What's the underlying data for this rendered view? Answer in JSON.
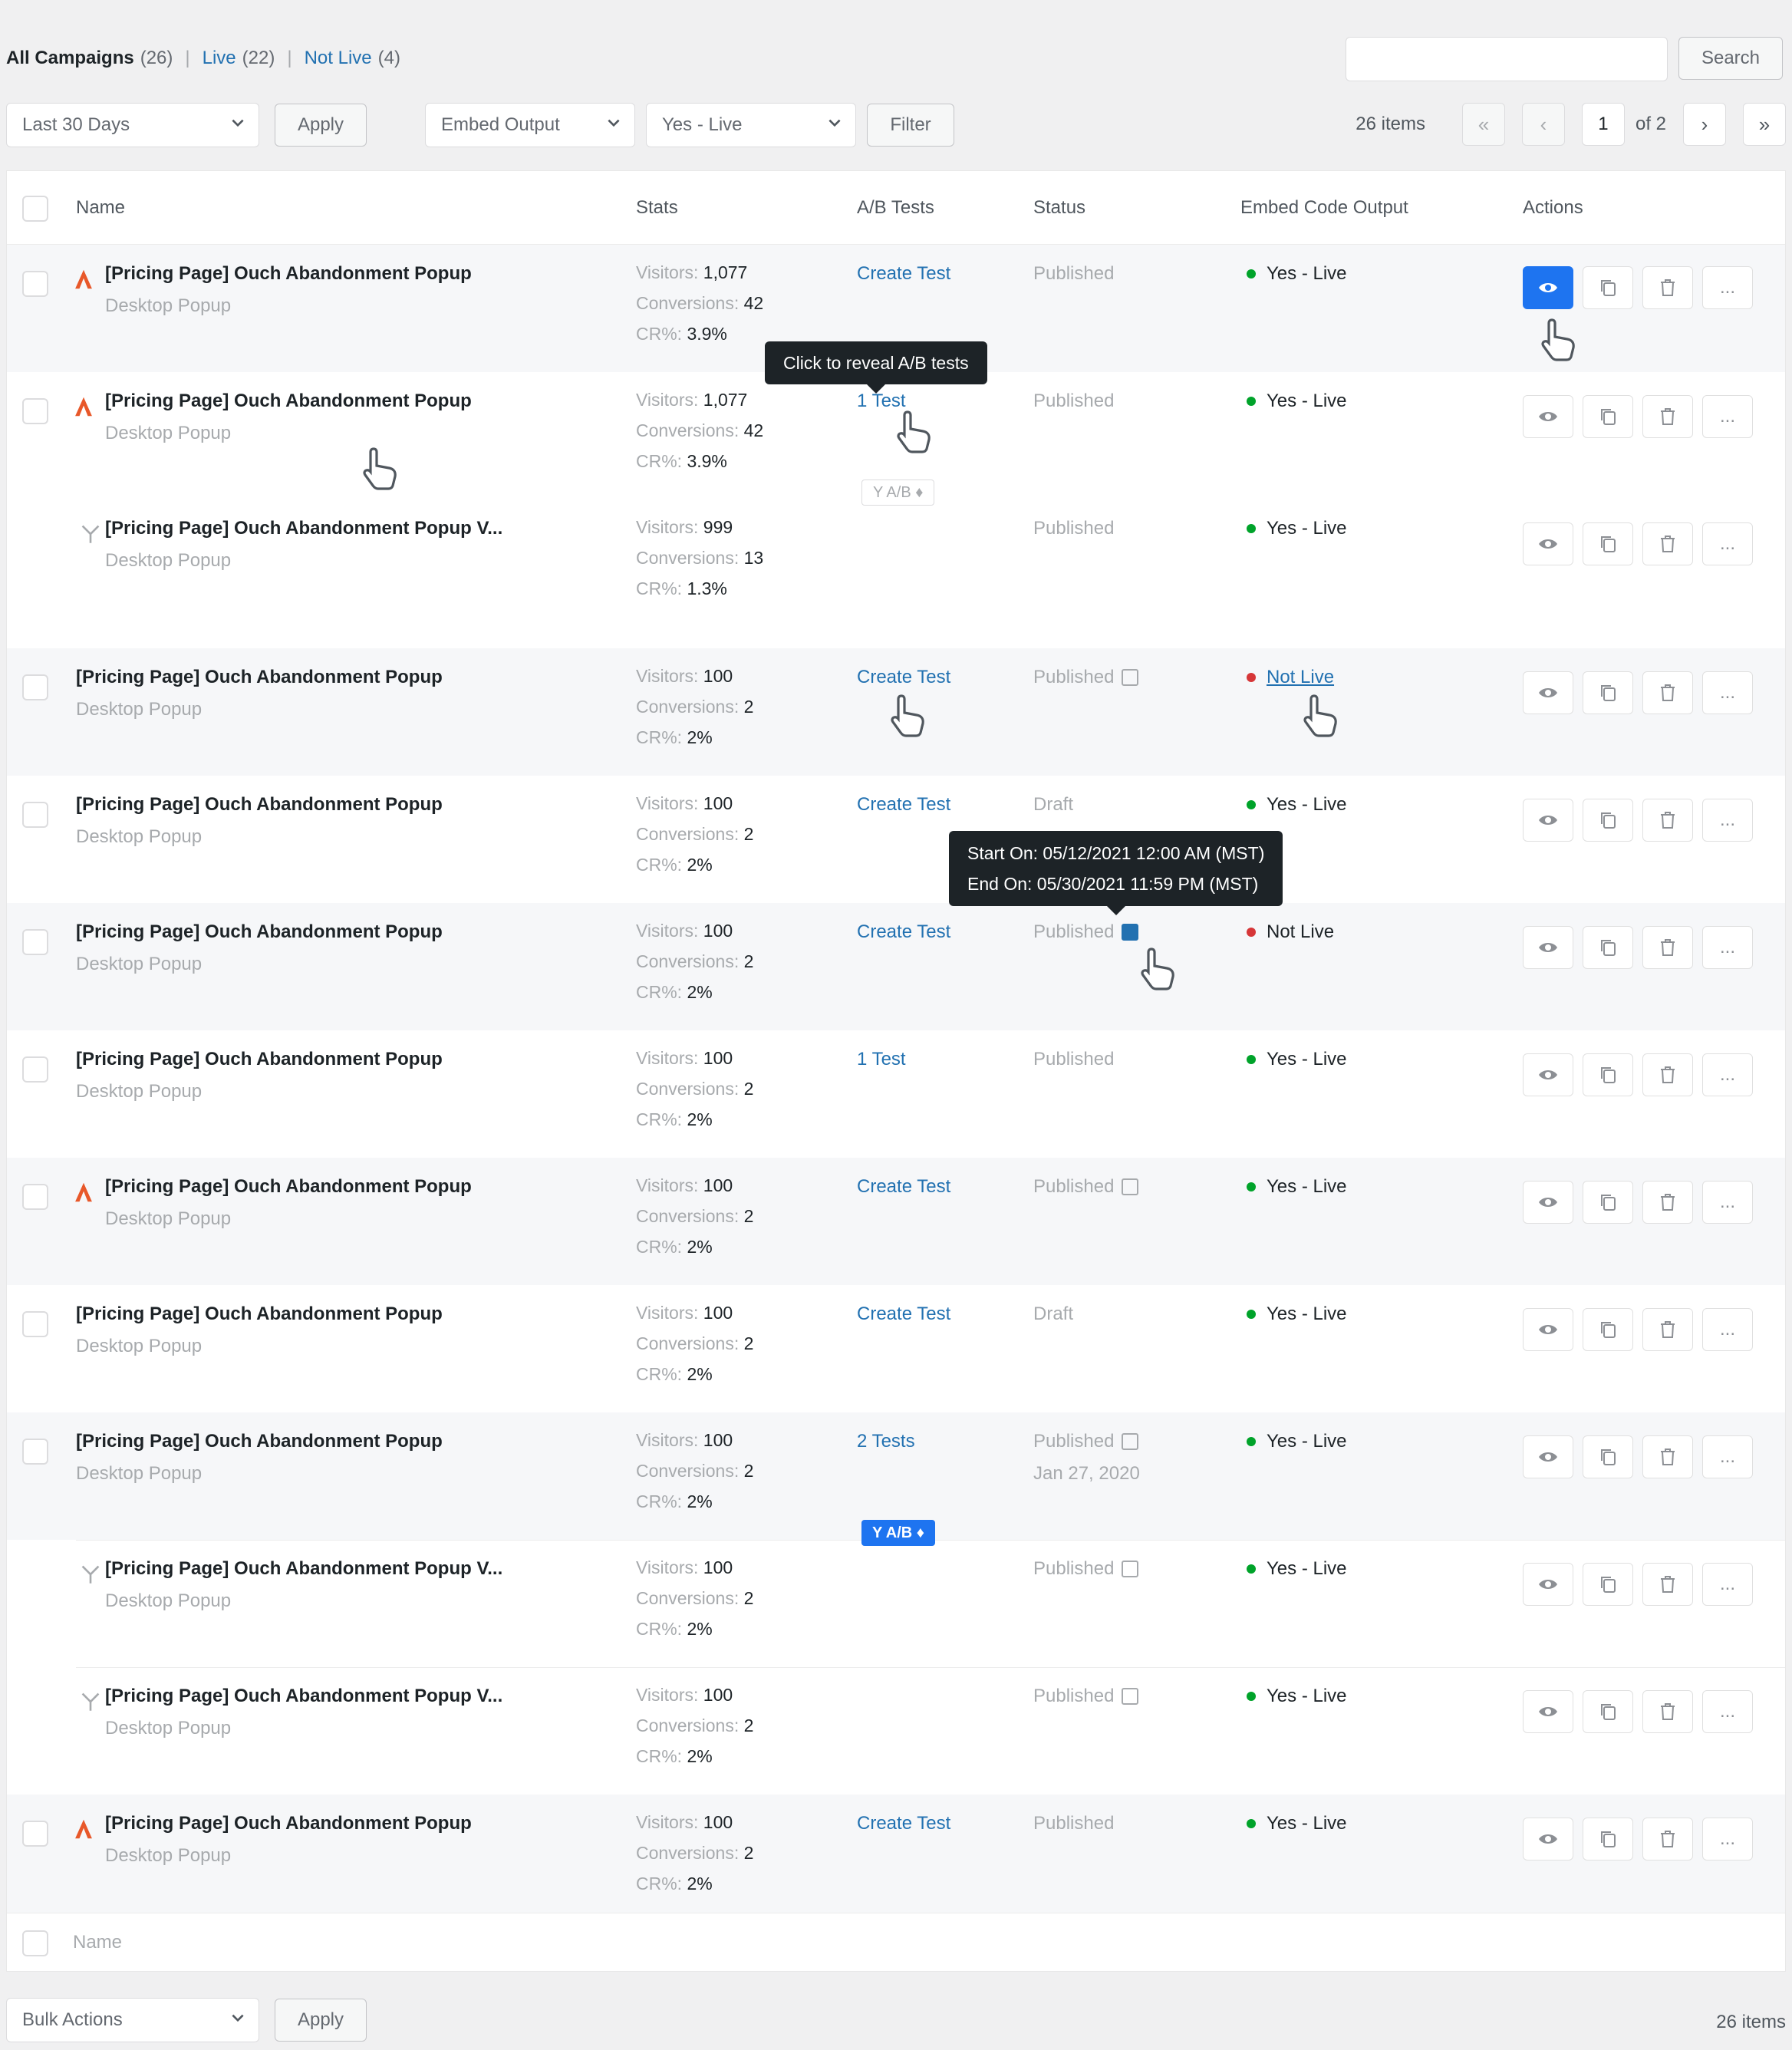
{
  "views": {
    "all_label": "All Campaigns",
    "all_count": "(26)",
    "live_label": "Live",
    "live_count": "(22)",
    "notlive_label": "Not Live",
    "notlive_count": "(4)",
    "separator": "|"
  },
  "search": {
    "button": "Search",
    "placeholder": ""
  },
  "filters": {
    "date_range": "Last 30 Days",
    "apply": "Apply",
    "embed_output": "Embed Output",
    "live_status": "Yes - Live",
    "filter": "Filter"
  },
  "pagination": {
    "items": "26 items",
    "first": "«",
    "prev": "‹",
    "current_page": "1",
    "of": "of 2",
    "next": "›",
    "last": "»"
  },
  "columns": {
    "name": "Name",
    "stats": "Stats",
    "ab_tests": "A/B Tests",
    "status": "Status",
    "embed": "Embed Code Output",
    "actions": "Actions"
  },
  "rows": [
    {
      "name": "[Pricing Page] Ouch Abandonment Popup",
      "sub": "Desktop Popup",
      "visitors": "1,077",
      "conversions": "42",
      "cr": "3.9%",
      "ab": "Create Test",
      "status": "Published",
      "embed": "Yes - Live"
    },
    {
      "name": "[Pricing Page] Ouch Abandonment Popup",
      "sub": "Desktop Popup",
      "visitors": "1,077",
      "conversions": "42",
      "cr": "3.9%",
      "ab": "1 Test",
      "status": "Published",
      "embed": "Yes - Live"
    },
    {
      "name": "[Pricing Page] Ouch Abandonment Popup V...",
      "sub": "Desktop Popup",
      "visitors": "999",
      "conversions": "13",
      "cr": "1.3%",
      "ab": "",
      "status": "Published",
      "embed": "Yes - Live"
    },
    {
      "name": "[Pricing Page] Ouch Abandonment Popup",
      "sub": "Desktop Popup",
      "visitors": "100",
      "conversions": "2",
      "cr": "2%",
      "ab": "Create Test",
      "status": "Published",
      "embed": "Not Live"
    },
    {
      "name": "[Pricing Page] Ouch Abandonment Popup",
      "sub": "Desktop Popup",
      "visitors": "100",
      "conversions": "2",
      "cr": "2%",
      "ab": "Create Test",
      "status": "Draft",
      "embed": "Yes - Live"
    },
    {
      "name": "[Pricing Page] Ouch Abandonment Popup",
      "sub": "Desktop Popup",
      "visitors": "100",
      "conversions": "2",
      "cr": "2%",
      "ab": "Create Test",
      "status": "Published",
      "embed": "Not Live"
    },
    {
      "name": "[Pricing Page] Ouch Abandonment Popup",
      "sub": "Desktop Popup",
      "visitors": "100",
      "conversions": "2",
      "cr": "2%",
      "ab": "1 Test",
      "status": "Published",
      "embed": "Yes - Live"
    },
    {
      "name": "[Pricing Page] Ouch Abandonment Popup",
      "sub": "Desktop Popup",
      "visitors": "100",
      "conversions": "2",
      "cr": "2%",
      "ab": "Create Test",
      "status": "Published",
      "embed": "Yes - Live"
    },
    {
      "name": "[Pricing Page] Ouch Abandonment Popup",
      "sub": "Desktop Popup",
      "visitors": "100",
      "conversions": "2",
      "cr": "2%",
      "ab": "Create Test",
      "status": "Draft",
      "embed": "Yes - Live"
    },
    {
      "name": "[Pricing Page] Ouch Abandonment Popup",
      "sub": "Desktop Popup",
      "visitors": "100",
      "conversions": "2",
      "cr": "2%",
      "ab": "2 Tests",
      "status": "Published",
      "status_date": "Jan 27, 2020",
      "embed": "Yes - Live"
    },
    {
      "name": "[Pricing Page] Ouch Abandonment Popup V...",
      "sub": "Desktop Popup",
      "visitors": "100",
      "conversions": "2",
      "cr": "2%",
      "ab": "",
      "status": "Published",
      "embed": "Yes - Live"
    },
    {
      "name": "[Pricing Page] Ouch Abandonment Popup V...",
      "sub": "Desktop Popup",
      "visitors": "100",
      "conversions": "2",
      "cr": "2%",
      "ab": "",
      "status": "Published",
      "embed": "Yes - Live"
    },
    {
      "name": "[Pricing Page] Ouch Abandonment Popup",
      "sub": "Desktop Popup",
      "visitors": "100",
      "conversions": "2",
      "cr": "2%",
      "ab": "Create Test",
      "status": "Published",
      "embed": "Yes - Live"
    }
  ],
  "stat_labels": {
    "visitors": "Visitors:",
    "conversions": "Conversions:",
    "cr": "CR%:"
  },
  "badges": {
    "ab": "Y A/B ♦"
  },
  "tooltips": {
    "ab": "Click to reveal A/B tests",
    "schedule_start": "Start On: 05/12/2021 12:00 AM (MST)",
    "schedule_end": "End On: 05/30/2021 11:59 PM (MST)"
  },
  "icons": {
    "warning": "warning-icon",
    "variation": "split-icon",
    "view": "eye-icon",
    "duplicate": "copy-icon",
    "delete": "trash-icon",
    "more": "ellipsis-icon",
    "calendar": "calendar-icon"
  },
  "more_label": "...",
  "footer": {
    "name": "Name",
    "bulk_actions": "Bulk Actions",
    "apply": "Apply",
    "items": "26 items"
  },
  "colors": {
    "accent": "#1e74f0",
    "link": "#2271b1",
    "live": "#00a32a",
    "notlive": "#d63638",
    "warning": "#e8582a"
  }
}
